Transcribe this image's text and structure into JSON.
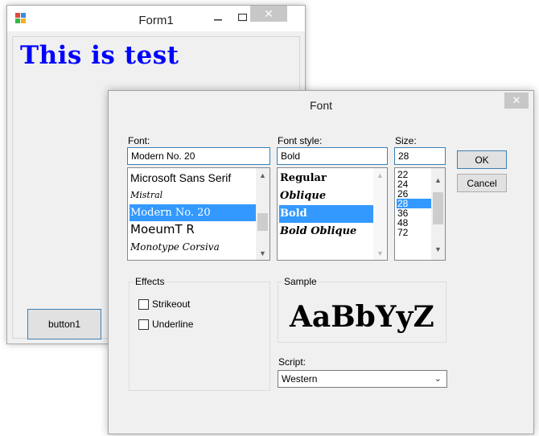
{
  "form1": {
    "title": "Form1",
    "label_text": "This is test",
    "button_label": "button1"
  },
  "font_dialog": {
    "title": "Font",
    "font_label": "Font:",
    "font_value": "Modern No. 20",
    "font_list": [
      "Microsoft Sans Serif",
      "Mistral",
      "Modern No. 20",
      "MoeumT R",
      "Monotype Corsiva"
    ],
    "selected_font_index": 2,
    "style_label": "Font style:",
    "style_value": "Bold",
    "style_list": [
      "Regular",
      "Oblique",
      "Bold",
      "Bold Oblique"
    ],
    "selected_style_index": 2,
    "size_label": "Size:",
    "size_value": "28",
    "size_list": [
      "22",
      "24",
      "26",
      "28",
      "36",
      "48",
      "72"
    ],
    "selected_size_index": 3,
    "ok_label": "OK",
    "cancel_label": "Cancel",
    "effects_label": "Effects",
    "strikeout_label": "Strikeout",
    "underline_label": "Underline",
    "sample_label": "Sample",
    "sample_text": "AaBbYyZ",
    "script_label": "Script:",
    "script_value": "Western"
  },
  "colors": {
    "label_text": "#0000ff",
    "selection": "#3399ff",
    "focus_border": "#3c7fb1"
  }
}
